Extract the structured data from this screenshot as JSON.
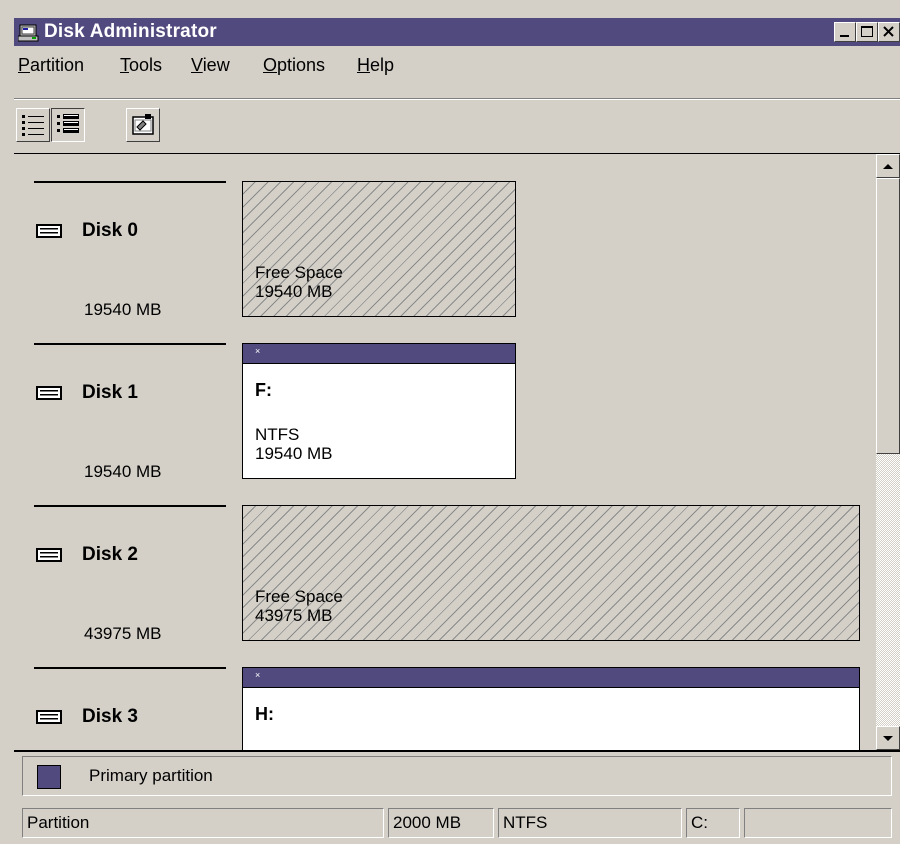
{
  "window": {
    "title": "Disk Administrator",
    "icon": "disk-administrator-icon",
    "controls": [
      "minimize-icon",
      "maximize-icon",
      "close-icon"
    ]
  },
  "menu": {
    "items": [
      {
        "key": "P",
        "rest": "artition"
      },
      {
        "key": "T",
        "rest": "ools"
      },
      {
        "key": "V",
        "rest": "iew"
      },
      {
        "key": "O",
        "rest": "ptions"
      },
      {
        "key": "H",
        "rest": "elp"
      }
    ]
  },
  "toolbar": {
    "buttons": [
      "volumes-view-icon",
      "disk-configuration-view-icon",
      "properties-icon"
    ],
    "pressed": "disk-configuration-view-icon"
  },
  "disks": [
    {
      "name": "Disk 0",
      "size": "19540 MB",
      "partitions": [
        {
          "type": "free",
          "label": "Free Space",
          "size": "19540 MB"
        }
      ]
    },
    {
      "name": "Disk 1",
      "size": "19540 MB",
      "partitions": [
        {
          "type": "primary",
          "drive": "F:",
          "fs": "NTFS",
          "size": "19540 MB",
          "marker": "×"
        }
      ]
    },
    {
      "name": "Disk 2",
      "size": "43975 MB",
      "partitions": [
        {
          "type": "free",
          "label": "Free Space",
          "size": "43975 MB"
        }
      ]
    },
    {
      "name": "Disk 3",
      "partitions": [
        {
          "type": "primary",
          "drive": "H:",
          "marker": "×"
        }
      ]
    }
  ],
  "legend": {
    "label": "Primary partition",
    "color": "#514a7e"
  },
  "statusbar": {
    "cells": [
      "Partition",
      "2000 MB",
      "NTFS",
      "C:",
      ""
    ]
  },
  "colors": {
    "face": "#d4d0c8",
    "title_bar": "#514a7e",
    "primary_partition": "#514a7e"
  }
}
